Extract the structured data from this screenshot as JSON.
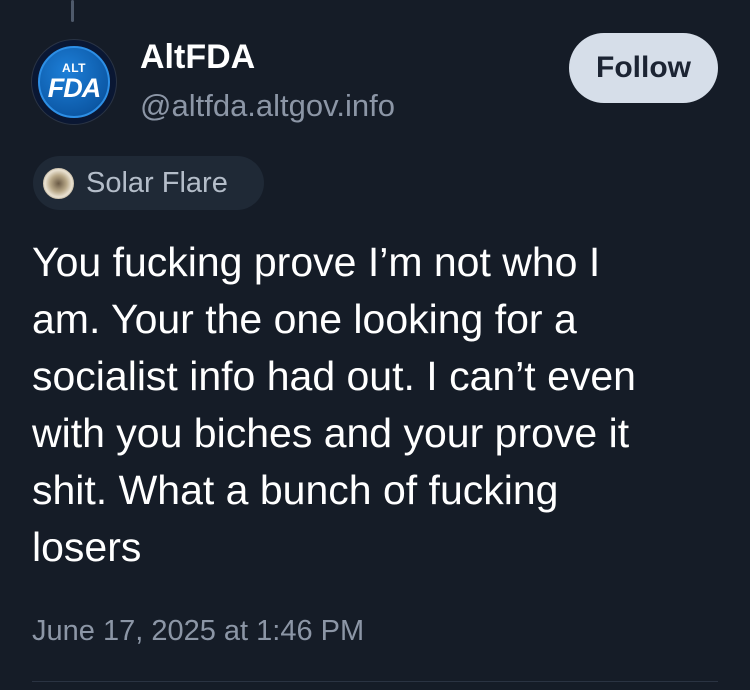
{
  "author": {
    "display_name": "AltFDA",
    "handle": "@altfda.altgov.info",
    "avatar": {
      "top_text": "ALT",
      "main_text": "FDA"
    }
  },
  "actions": {
    "follow_label": "Follow"
  },
  "label_chip": {
    "icon": "labeler-badge-icon",
    "text": "Solar Flare"
  },
  "post": {
    "lines": [
      "You fucking prove I’m not who I",
      "am. Your the one looking for a",
      "socialist info had out. I can’t even",
      "with you biches and your prove it",
      "shit. What a bunch of fucking",
      "losers"
    ],
    "timestamp": "June 17, 2025 at 1:46 PM"
  },
  "colors": {
    "background": "#151c27",
    "follow_button_bg": "#d6dee9",
    "secondary_text": "#8c96a6"
  }
}
